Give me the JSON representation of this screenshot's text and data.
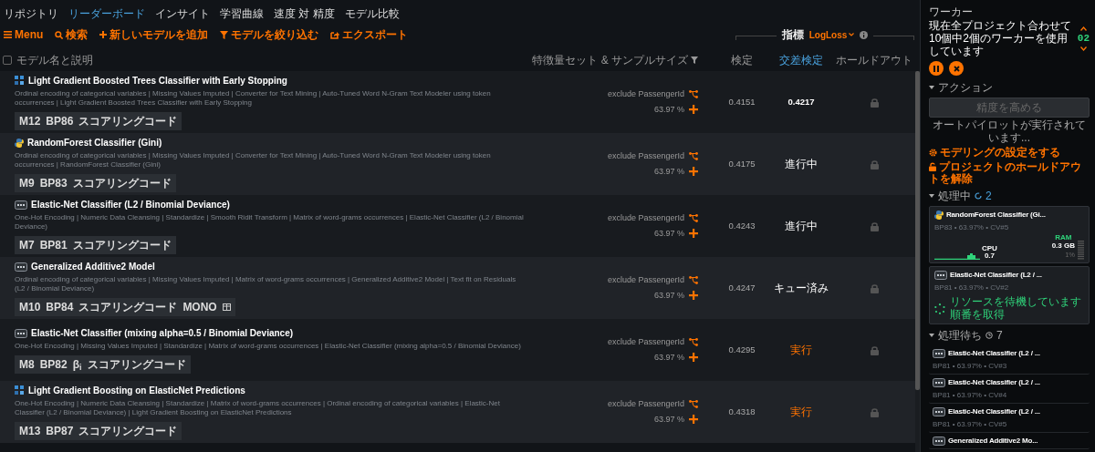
{
  "nav_tabs": [
    {
      "label": "リポジトリ",
      "selected": false
    },
    {
      "label": "リーダーボード",
      "selected": true
    },
    {
      "label": "インサイト",
      "selected": false
    },
    {
      "label": "学習曲線",
      "selected": false
    },
    {
      "label": "速度 対 精度",
      "selected": false
    },
    {
      "label": "モデル比較",
      "selected": false
    }
  ],
  "toolbar": [
    {
      "kind": "menu",
      "label": "Menu"
    },
    {
      "kind": "search",
      "label": "検索"
    },
    {
      "kind": "add",
      "label": "新しいモデルを追加"
    },
    {
      "kind": "filter",
      "label": "モデルを絞り込む"
    },
    {
      "kind": "export",
      "label": "エクスポート"
    }
  ],
  "metric": {
    "label": "指標",
    "value": "LogLoss"
  },
  "select_all": {
    "label": "モデル名と説明",
    "checked": false
  },
  "columns": [
    {
      "label": "特徴量セット & サンプルサイズ",
      "selected": false
    },
    {
      "label": "検定",
      "selected": false
    },
    {
      "label": "交差検定",
      "selected": true
    },
    {
      "label": "ホールドアウト",
      "selected": false
    }
  ],
  "rows": [
    {
      "kind": "lightgbm",
      "title": "Light Gradient Boosted Trees Classifier with Early Stopping",
      "description": "Ordinal encoding of categorical variables | Missing Values Imputed | Converter for Text Mining | Auto-Tuned Word N-Gram Text Modeler using token occurrences | Light Gradient Boosted Trees Classifier with Early Stopping",
      "tags": [
        {
          "kind": "text",
          "text": "M12"
        },
        {
          "kind": "text",
          "text": "BP86"
        },
        {
          "kind": "text",
          "text": "スコアリングコード"
        }
      ],
      "feature_list": "exclude PassengerId",
      "sample_size": "63.97 %",
      "validation": "0.4151",
      "cross_validation": {
        "kind": "score",
        "text": "0.4217"
      },
      "holdout_locked": true
    },
    {
      "kind": "python",
      "title": "RandomForest Classifier (Gini)",
      "description": "Ordinal encoding of categorical variables | Missing Values Imputed | Converter for Text Mining | Auto-Tuned Word N-Gram Text Modeler using token occurrences | RandomForest Classifier (Gini)",
      "tags": [
        {
          "kind": "text",
          "text": "M9"
        },
        {
          "kind": "text",
          "text": "BP83"
        },
        {
          "kind": "text",
          "text": "スコアリングコード"
        }
      ],
      "feature_list": "exclude PassengerId",
      "sample_size": "63.97 %",
      "validation": "0.4175",
      "cross_validation": {
        "kind": "status",
        "text": "進行中"
      },
      "holdout_locked": true
    },
    {
      "kind": "blueprint",
      "title": "Elastic-Net Classifier (L2 / Binomial Deviance)",
      "description": "One-Hot Encoding | Numeric Data Cleansing | Standardize | Smooth Ridit Transform | Matrix of word-grams occurrences | Elastic-Net Classifier (L2 / Binomial Deviance)",
      "tags": [
        {
          "kind": "text",
          "text": "M7"
        },
        {
          "kind": "text",
          "text": "BP81"
        },
        {
          "kind": "text",
          "text": "スコアリングコード"
        }
      ],
      "feature_list": "exclude PassengerId",
      "sample_size": "63.97 %",
      "validation": "0.4243",
      "cross_validation": {
        "kind": "status",
        "text": "進行中"
      },
      "holdout_locked": true
    },
    {
      "kind": "blueprint",
      "title": "Generalized Additive2 Model",
      "description": "Ordinal encoding of categorical variables | Missing Values Imputed | Matrix of word-grams occurrences | Generalized Additive2 Model | Text fit on Residuals (L2 / Binomial Deviance)",
      "tags": [
        {
          "kind": "text",
          "text": "M10"
        },
        {
          "kind": "text",
          "text": "BP84"
        },
        {
          "kind": "text",
          "text": "スコアリングコード"
        },
        {
          "kind": "text",
          "text": "MONO"
        },
        {
          "kind": "table"
        }
      ],
      "feature_list": "exclude PassengerId",
      "sample_size": "63.97 %",
      "validation": "0.4247",
      "cross_validation": {
        "kind": "status",
        "text": "キュー済み"
      },
      "holdout_locked": true
    },
    {
      "kind": "blueprint",
      "title": "Elastic-Net Classifier (mixing alpha=0.5 / Binomial Deviance)",
      "description": "One-Hot Encoding | Missing Values Imputed | Standardize | Matrix of word-grams occurrences | Elastic-Net Classifier (mixing alpha=0.5 / Binomial Deviance)",
      "tags": [
        {
          "kind": "text",
          "text": "M8"
        },
        {
          "kind": "text",
          "text": "BP82"
        },
        {
          "kind": "text",
          "text": "β$_{i}$"
        },
        {
          "kind": "text",
          "text": "スコアリングコード"
        }
      ],
      "feature_list": "exclude PassengerId",
      "sample_size": "63.97 %",
      "validation": "0.4295",
      "cross_validation": {
        "kind": "action",
        "text": "実行"
      },
      "holdout_locked": true
    },
    {
      "kind": "lightgbm",
      "title": "Light Gradient Boosting on ElasticNet Predictions",
      "description": "One-Hot Encoding | Numeric Data Cleansing | Standardize | Matrix of word-grams occurrences | Ordinal encoding of categorical variables | Elastic-Net Classifier (L2 / Binomial Deviance) | Light Gradient Boosting on ElasticNet Predictions",
      "tags": [
        {
          "kind": "text",
          "text": "M13"
        },
        {
          "kind": "text",
          "text": "BP87"
        },
        {
          "kind": "text",
          "text": "スコアリングコード"
        }
      ],
      "feature_list": "exclude PassengerId",
      "sample_size": "63.97 %",
      "validation": "0.4318",
      "cross_validation": {
        "kind": "action",
        "text": "実行"
      },
      "holdout_locked": true
    }
  ],
  "workers": {
    "title": "ワーカー",
    "message": "現在全プロジェクト合わせて10個中2個のワーカーを使用しています",
    "count": "02"
  },
  "actions": {
    "title": "アクション",
    "expanded": true,
    "button": {
      "label": "精度を高める",
      "disabled": true
    },
    "status": "オートパイロットが実行されています...",
    "links": [
      {
        "kind": "settings",
        "label": "モデリングの設定をする"
      },
      {
        "kind": "unlock",
        "label": "プロジェクトのホールドアウトを解除"
      }
    ]
  },
  "processing": {
    "title": "処理中",
    "expanded": true,
    "count": "2",
    "jobs": [
      {
        "kind": "python",
        "title": "RandomForest Classifier (Gi...",
        "meta": "BP83 • 63.97% • CV#5",
        "cpu_label": "CPU",
        "cpu": "0.7",
        "ram_label": "RAM",
        "ram": "0.3 GB",
        "ram_pct": "1%"
      },
      {
        "kind": "blueprint",
        "title": "Elastic-Net Classifier (L2 / ...",
        "meta": "BP81 • 63.97% • CV#2",
        "messages": [
          "リソースを待機しています",
          "順番を取得"
        ]
      }
    ]
  },
  "queue": {
    "title": "処理待ち",
    "expanded": true,
    "count": "7",
    "jobs": [
      {
        "kind": "blueprint",
        "title": "Elastic-Net Classifier (L2 / ...",
        "meta": "BP81 • 63.97% • CV#3"
      },
      {
        "kind": "blueprint",
        "title": "Elastic-Net Classifier (L2 / ...",
        "meta": "BP81 • 63.97% • CV#4"
      },
      {
        "kind": "blueprint",
        "title": "Elastic-Net Classifier (L2 / ...",
        "meta": "BP81 • 63.97% • CV#5"
      },
      {
        "kind": "blueprint",
        "title": "Generalized Additive2 Mo..."
      }
    ]
  }
}
